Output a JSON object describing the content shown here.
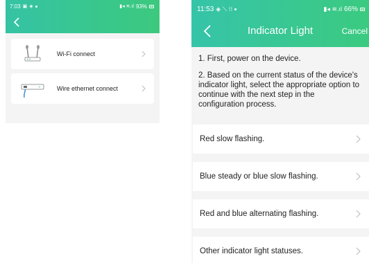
{
  "left_screen": {
    "status_bar": {
      "time": "7:03",
      "battery": "93%"
    },
    "connections": [
      {
        "label": "Wi-Fi connect",
        "icon": "wifi-router-icon"
      },
      {
        "label": "Wire ethernet connect",
        "icon": "ethernet-router-icon"
      }
    ]
  },
  "right_screen": {
    "status_bar": {
      "time": "11:53",
      "battery": "66%"
    },
    "title": "Indicator Light",
    "cancel_label": "Cancel",
    "instructions": [
      "1. First, power on the device.",
      "2. Based on the current status of the device's indicator light, select the appropriate option to continue with the next step in the configuration process."
    ],
    "options": [
      "Red slow flashing.",
      "Blue steady or blue slow flashing.",
      "Red and blue alternating flashing.",
      "Other indicator light statuses."
    ]
  },
  "colors": {
    "header_start": "#35c3a4",
    "header_end": "#3cc97e",
    "background": "#f4f4f4",
    "card": "#ffffff"
  }
}
